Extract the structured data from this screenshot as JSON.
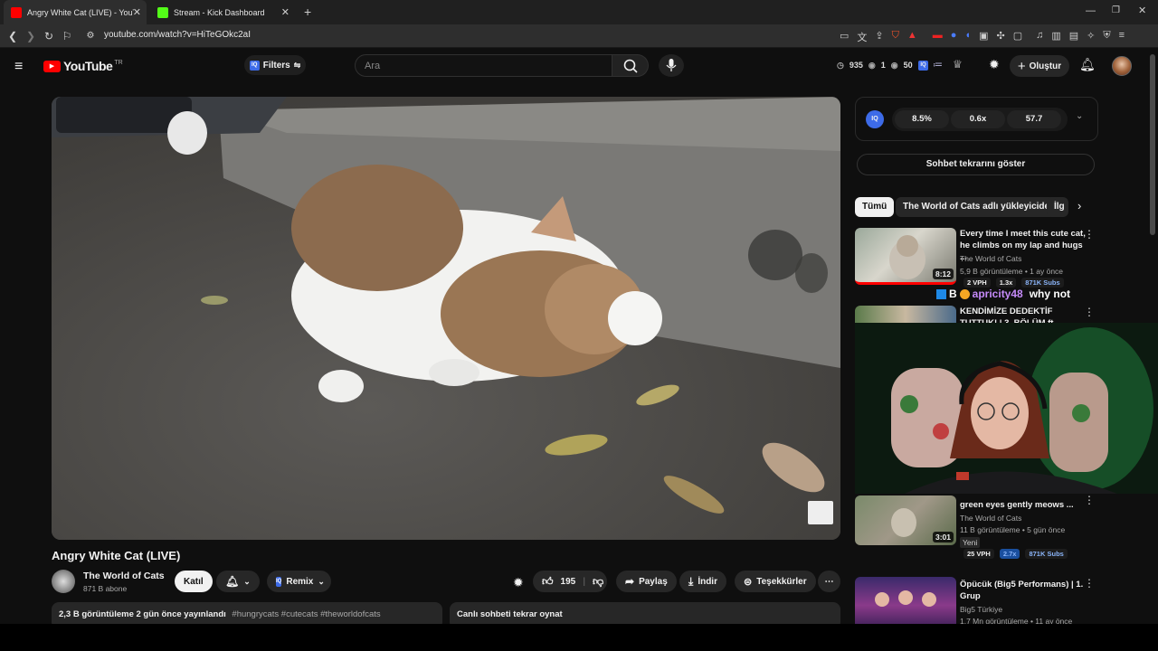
{
  "browser": {
    "tabs": [
      {
        "title": "Angry White Cat (LIVE) - YouTube",
        "favicon_color": "#ff0000"
      },
      {
        "title": "Stream - Kick Dashboard",
        "favicon_color": "#53fc18"
      }
    ],
    "url": "youtube.com/watch?v=HiTeGOkc2aI"
  },
  "header": {
    "logo_text": "YouTube",
    "region": "TR",
    "filters_label": "Filters",
    "search_placeholder": "Ara",
    "stats": {
      "watching": "935",
      "eye": "1",
      "viewers": "50"
    },
    "create_label": "Oluştur"
  },
  "video": {
    "title": "Angry White Cat (LIVE)",
    "channel": "The World of Cats",
    "subscribers": "871 B abone",
    "join_label": "Katıl",
    "remix_label": "Remix",
    "likes": "195",
    "share_label": "Paylaş",
    "download_label": "İndir",
    "thanks_label": "Teşekkürler",
    "description": {
      "views_date": "2,3 B görüntüleme  2 gün önce yayınlandı",
      "hashtags": "#hungrycats #cutecats #theworldofcats"
    },
    "chat_replay_label": "Canlı sohbeti tekrar oynat"
  },
  "iq_panel": {
    "values": [
      "8.5%",
      "0.6x",
      "57.7"
    ],
    "logo": "IQ"
  },
  "show_chat_label": "Sohbet tekrarını göster",
  "filter_chips": [
    "Tümü",
    "The World of Cats adlı yükleyiciden",
    "İlg"
  ],
  "recommendations": [
    {
      "title": "Every time I meet this cute cat, he climbs on my lap and hugs ...",
      "channel": "The World of Cats",
      "meta": "5,9 B görüntüleme • 1 ay önce",
      "duration": "8:12",
      "badges": [
        "2 VPH",
        "1.3x",
        "871K Subs"
      ]
    },
    {
      "title": "KENDİMİZE DEDEKTİF TUTTUK! | 3. BÖLÜM ft. @uborkulaz",
      "channel": "",
      "meta": "",
      "duration": "",
      "badges": []
    },
    {
      "title": "green eyes gently meows ...",
      "channel": "The World of Cats",
      "meta": "11 B görüntüleme • 5 gün önce",
      "new_badge": "Yeni",
      "duration": "3:01",
      "badges": [
        "25 VPH",
        "2.7x",
        "871K Subs"
      ]
    },
    {
      "title": "Öpücük (Big5 Performans) | 1. Grup",
      "channel": "Big5 Türkiye",
      "meta": "1,7 Mn görüntüleme • 11 ay önce",
      "duration": "",
      "badges": []
    }
  ],
  "chat_overlay": {
    "user": "apricity48",
    "message": "why not",
    "badge_letter": "B"
  },
  "colors": {
    "bg": "#0f0f0f",
    "accent_blue": "#3ea6ff",
    "red": "#ff0000"
  }
}
